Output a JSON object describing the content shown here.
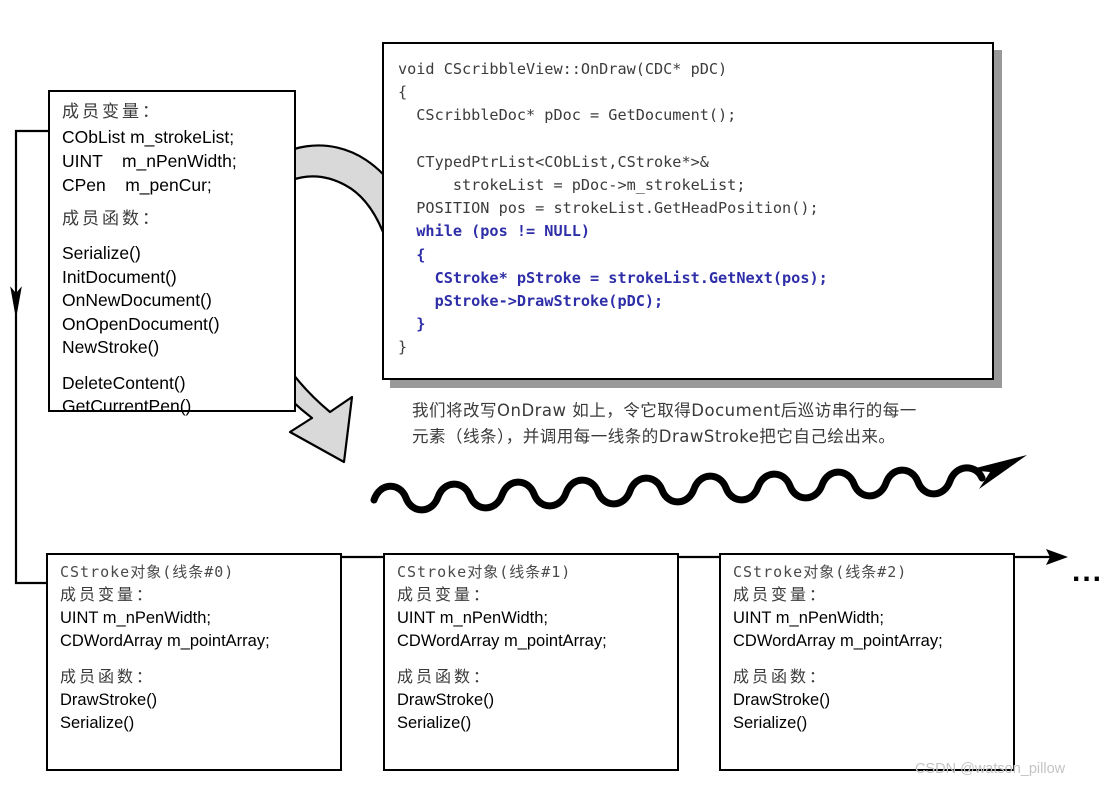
{
  "doc_box": {
    "members_heading": "成员变量：",
    "member_vars": [
      "CObList m_strokeList;",
      "UINT    m_nPenWidth;",
      "CPen    m_penCur;"
    ],
    "functions_heading": "成员函数：",
    "functions_group_1": [
      "Serialize()",
      "InitDocument()",
      "OnNewDocument()",
      "OnOpenDocument()",
      "NewStroke()"
    ],
    "functions_group_2": [
      "DeleteContent()",
      "GetCurrentPen()"
    ]
  },
  "code_box": {
    "language": "cpp",
    "lines": [
      {
        "text": "void CScribbleView::OnDraw(CDC* pDC)",
        "style": "plain"
      },
      {
        "text": "{",
        "style": "plain"
      },
      {
        "text": "  CScribbleDoc* pDoc = GetDocument();",
        "style": "plain"
      },
      {
        "text": "",
        "style": "plain"
      },
      {
        "text": "  CTypedPtrList<CObList,CStroke*>&",
        "style": "plain"
      },
      {
        "text": "      strokeList = pDoc->m_strokeList;",
        "style": "plain"
      },
      {
        "text": "  POSITION pos = strokeList.GetHeadPosition();",
        "style": "plain"
      },
      {
        "text": "  while (pos != NULL)",
        "style": "highlight"
      },
      {
        "text": "  {",
        "style": "highlight"
      },
      {
        "text": "    CStroke* pStroke = strokeList.GetNext(pos);",
        "style": "highlight"
      },
      {
        "text": "    pStroke->DrawStroke(pDC);",
        "style": "highlight"
      },
      {
        "text": "  }",
        "style": "highlight"
      },
      {
        "text": "}",
        "style": "plain"
      }
    ],
    "highlight_color": "#2e2ea8",
    "plain_color": "#3c3c3c",
    "shadow_color": "#999999"
  },
  "caption": {
    "line1": "我们将改写OnDraw 如上，令它取得Document后巡访串行的每一",
    "line2": "元素（线条），并调用每一线条的DrawStroke把它自己绘出来。"
  },
  "stroke_boxes": [
    {
      "title": "CStroke对象(线条#0)",
      "members_heading": "成员变量：",
      "member_vars": [
        "UINT m_nPenWidth;",
        "CDWordArray m_pointArray;"
      ],
      "functions_heading": "成员函数：",
      "functions": [
        "DrawStroke()",
        "Serialize()"
      ]
    },
    {
      "title": "CStroke对象(线条#1)",
      "members_heading": "成员变量：",
      "member_vars": [
        "UINT m_nPenWidth;",
        "CDWordArray m_pointArray;"
      ],
      "functions_heading": "成员函数：",
      "functions": [
        "DrawStroke()",
        "Serialize()"
      ]
    },
    {
      "title": "CStroke对象(线条#2)",
      "members_heading": "成员变量：",
      "member_vars": [
        "UINT m_nPenWidth;",
        "CDWordArray m_pointArray;"
      ],
      "functions_heading": "成员函数：",
      "functions": [
        "DrawStroke()",
        "Serialize()"
      ]
    }
  ],
  "ellipsis": "...",
  "watermark": "CSDN @watson_pillow",
  "colors": {
    "arrow_fill": "#d9d9d9",
    "arrow_stroke": "#000000",
    "line": "#000000",
    "watermark": "#c4c4c4"
  }
}
